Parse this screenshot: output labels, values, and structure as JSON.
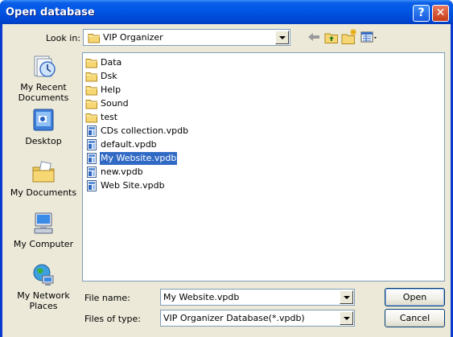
{
  "window": {
    "title": "Open database",
    "help_label": "?",
    "close_label": "✕"
  },
  "lookin": {
    "label": "Look in:",
    "value": "VIP Organizer"
  },
  "places": [
    {
      "label": "My Recent Documents",
      "icon": "recent-documents-icon"
    },
    {
      "label": "Desktop",
      "icon": "desktop-icon"
    },
    {
      "label": "My Documents",
      "icon": "my-documents-icon"
    },
    {
      "label": "My Computer",
      "icon": "my-computer-icon"
    },
    {
      "label": "My Network Places",
      "icon": "network-places-icon"
    }
  ],
  "files": [
    {
      "name": "Data",
      "type": "folder"
    },
    {
      "name": "Dsk",
      "type": "folder"
    },
    {
      "name": "Help",
      "type": "folder"
    },
    {
      "name": "Sound",
      "type": "folder"
    },
    {
      "name": "test",
      "type": "folder"
    },
    {
      "name": "CDs collection.vpdb",
      "type": "file"
    },
    {
      "name": "default.vpdb",
      "type": "file"
    },
    {
      "name": "My Website.vpdb",
      "type": "file",
      "selected": true
    },
    {
      "name": "new.vpdb",
      "type": "file"
    },
    {
      "name": "Web Site.vpdb",
      "type": "file"
    }
  ],
  "filename": {
    "label": "File name:",
    "value": "My Website.vpdb"
  },
  "filetype": {
    "label": "Files of type:",
    "value": "VIP Organizer Database(*.vpdb)"
  },
  "buttons": {
    "open": "Open",
    "cancel": "Cancel"
  },
  "colors": {
    "titlebar": "#0055e5",
    "selection": "#316ac5",
    "dialog_bg": "#ece9d8"
  }
}
